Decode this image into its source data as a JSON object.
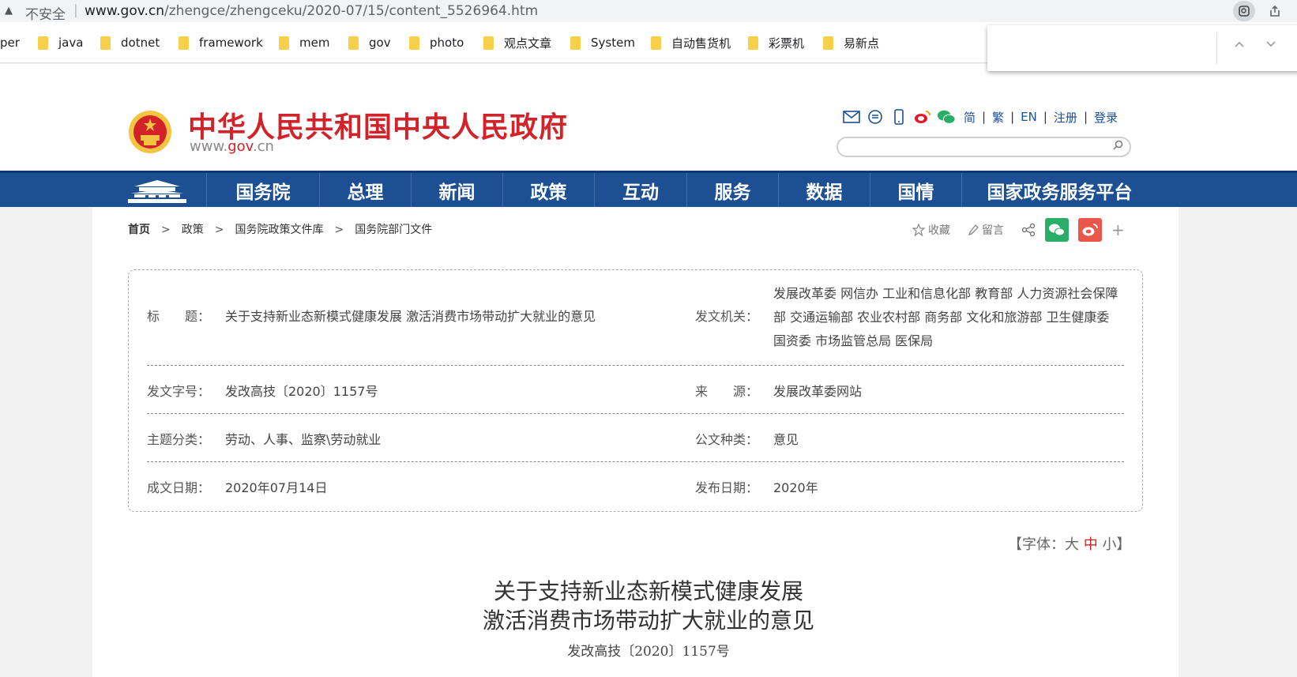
{
  "browser": {
    "insecure_label": "不安全",
    "separator": "|",
    "url_host": "www.gov.cn",
    "url_path": "/zhengce/zhengceku/2020-07/15/content_5526964.htm"
  },
  "bookmarks": [
    "per",
    "java",
    "dotnet",
    "framework",
    "mem",
    "gov",
    "photo",
    "观点文章",
    "System",
    "自动售货机",
    "彩票机",
    "易新点"
  ],
  "header": {
    "site_title": "中华人民共和国中央人民政府",
    "domain_pre": "www.",
    "domain_mid": "gov",
    "domain_post": ".cn",
    "lang_simplified": "简",
    "lang_traditional": "繁",
    "lang_en": "EN",
    "register": "注册",
    "login": "登录",
    "pipe": "|"
  },
  "nav": [
    "国务院",
    "总理",
    "新闻",
    "政策",
    "互动",
    "服务",
    "数据",
    "国情",
    "国家政务服务平台"
  ],
  "breadcrumb": {
    "home": "首页",
    "level1": "政策",
    "level2": "国务院政策文件库",
    "level3": "国务院部门文件",
    "arrow": ">"
  },
  "share": {
    "favorite": "收藏",
    "comment": "留言",
    "plus": "+"
  },
  "meta": {
    "title_label": "标　　题：",
    "title_value": "关于支持新业态新模式健康发展 激活消费市场带动扩大就业的意见",
    "issuer_label": "发文机关：",
    "issuer_value": "发展改革委 网信办 工业和信息化部 教育部 人力资源社会保障部 交通运输部 农业农村部 商务部 文化和旅游部 卫生健康委 国资委 市场监管总局 医保局",
    "docno_label": "发文字号：",
    "docno_value": "发改高技〔2020〕1157号",
    "source_label": "来　　源：",
    "source_value": "发展改革委网站",
    "topic_label": "主题分类：",
    "topic_value": "劳动、人事、监察\\劳动就业",
    "type_label": "公文种类：",
    "type_value": "意见",
    "written_label": "成文日期：",
    "written_value": "2020年07月14日",
    "published_label": "发布日期：",
    "published_value": "2020年"
  },
  "fontsize": {
    "open": "【字体：",
    "large": "大",
    "medium": "中",
    "small": "小",
    "close": "】"
  },
  "document": {
    "title_line1": "关于支持新业态新模式健康发展",
    "title_line2": "激活消费市场带动扩大就业的意见",
    "doc_number": "发改高技〔2020〕1157号"
  },
  "colors": {
    "nav_blue": "#1d5093",
    "brand_red": "#d2232a",
    "link_blue": "#1a4e95",
    "wechat_green": "#2aae67",
    "weibo_red": "#e9574b"
  },
  "icons": [
    "warning-icon",
    "lens-icon",
    "share-icon",
    "folder-icon",
    "chevron-up-icon",
    "chevron-down-icon",
    "emblem-icon",
    "mail-icon",
    "chat-icon",
    "mobile-icon",
    "weibo-icon",
    "wechat-icon",
    "search-icon",
    "star-icon",
    "pencil-icon",
    "share-nodes-icon",
    "plus-icon"
  ]
}
